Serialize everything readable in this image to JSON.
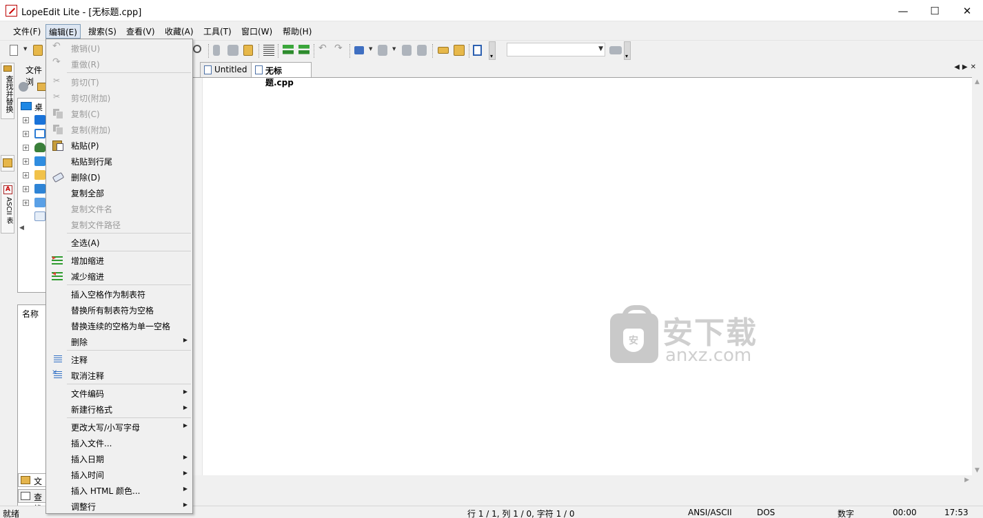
{
  "window": {
    "title": "LopeEdit Lite - [无标题.cpp]",
    "minimize_glyph": "—",
    "maximize_glyph": "☐",
    "close_glyph": "✕"
  },
  "menubar": [
    {
      "label": "文件(F)"
    },
    {
      "label": "编辑(E)",
      "active": true
    },
    {
      "label": "搜索(S)"
    },
    {
      "label": "查看(V)"
    },
    {
      "label": "收藏(A)"
    },
    {
      "label": "工具(T)"
    },
    {
      "label": "窗口(W)"
    },
    {
      "label": "帮助(H)"
    }
  ],
  "side_tabs": {
    "find_replace": "查找并替换",
    "ascii_table": "ASCII 表"
  },
  "file_panel": {
    "tab_label": "文件浏",
    "tree_desktop": "桌面",
    "list_header": "名称",
    "bottom_tab_files": "文件",
    "bottom_tab_search": "查找"
  },
  "doc_tabs": [
    {
      "label": "Untitled",
      "active": false
    },
    {
      "label": "无标题.cpp",
      "active": true
    }
  ],
  "watermark": {
    "cn": "安下载",
    "en": "anxz.com",
    "shield": "安"
  },
  "edit_menu": {
    "items": [
      {
        "label": "撤销(U)",
        "disabled": true,
        "icon": "undo-icon"
      },
      {
        "label": "重做(R)",
        "disabled": true,
        "icon": "redo-icon"
      },
      {
        "label": "剪切(T)",
        "disabled": true,
        "icon": "cut-icon"
      },
      {
        "label": "剪切(附加)",
        "disabled": true,
        "icon": "cut-append-icon"
      },
      {
        "label": "复制(C)",
        "disabled": true,
        "icon": "copy-icon"
      },
      {
        "label": "复制(附加)",
        "disabled": true,
        "icon": "copy-append-icon"
      },
      {
        "label": "粘贴(P)",
        "disabled": false,
        "icon": "paste-icon"
      },
      {
        "label": "粘贴到行尾",
        "disabled": false
      },
      {
        "label": "删除(D)",
        "disabled": false,
        "icon": "eraser-icon"
      },
      {
        "label": "复制全部",
        "disabled": false
      },
      {
        "label": "复制文件名",
        "disabled": true
      },
      {
        "label": "复制文件路径",
        "disabled": true
      },
      {
        "label": "全选(A)",
        "disabled": false
      },
      {
        "label": "增加缩进",
        "disabled": false,
        "icon": "indent-icon"
      },
      {
        "label": "减少缩进",
        "disabled": false,
        "icon": "outdent-icon"
      },
      {
        "label": "插入空格作为制表符",
        "disabled": false
      },
      {
        "label": "替换所有制表符为空格",
        "disabled": false
      },
      {
        "label": "替换连续的空格为单一空格",
        "disabled": false
      },
      {
        "label": "删除",
        "disabled": false,
        "submenu": true
      },
      {
        "label": "注释",
        "disabled": false,
        "icon": "comment-icon"
      },
      {
        "label": "取消注释",
        "disabled": false,
        "icon": "uncomment-icon"
      },
      {
        "label": "文件编码",
        "disabled": false,
        "submenu": true
      },
      {
        "label": "新建行格式",
        "disabled": false,
        "submenu": true
      },
      {
        "label": "更改大写/小写字母",
        "disabled": false,
        "submenu": true
      },
      {
        "label": "插入文件...",
        "disabled": false
      },
      {
        "label": "插入日期",
        "disabled": false,
        "submenu": true
      },
      {
        "label": "插入时间",
        "disabled": false,
        "submenu": true
      },
      {
        "label": "插入 HTML 颜色...",
        "disabled": false,
        "submenu": true
      },
      {
        "label": "调整行",
        "disabled": false,
        "submenu": true
      }
    ],
    "submenu_arrow": "▶"
  },
  "statusbar": {
    "ready": "就绪",
    "position": "行 1 / 1, 列 1 / 0, 字符 1 / 0",
    "encoding": "ANSI/ASCII",
    "line_format": "DOS",
    "numlock": "数字",
    "elapsed": "00:00",
    "clock": "17:53"
  },
  "colors": {
    "accent": "#3f6fc1",
    "menu_active_bg": "#dde6f2",
    "disabled_text": "#9a9a9a"
  }
}
